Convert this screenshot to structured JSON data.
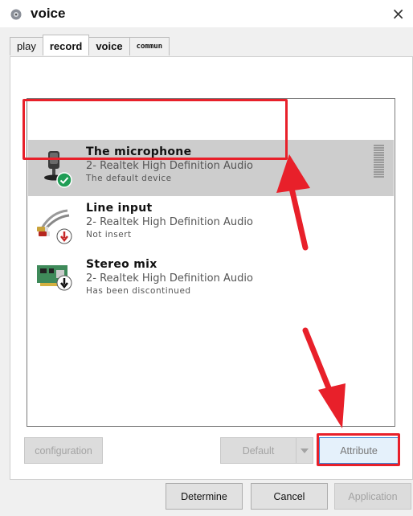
{
  "window": {
    "title": "voice",
    "close_glyph": "×"
  },
  "tabs": [
    {
      "label": "play"
    },
    {
      "label": "record"
    },
    {
      "label": "voice"
    },
    {
      "label": "commun"
    }
  ],
  "devices": [
    {
      "name": "The microphone",
      "driver": "2- Realtek High Definition Audio",
      "status": "The default device",
      "icon": "microphone-icon",
      "badge": "check-badge-icon",
      "selected": true
    },
    {
      "name": "Line input",
      "driver": "2- Realtek High Definition Audio",
      "status": "Not insert",
      "icon": "line-input-cable-icon",
      "badge": "down-arrow-red-badge-icon"
    },
    {
      "name": "Stereo mix",
      "driver": "2- Realtek High Definition Audio",
      "status": "Has been discontinued",
      "icon": "sound-card-icon",
      "badge": "down-arrow-black-badge-icon"
    }
  ],
  "buttons": {
    "configuration": "configuration",
    "default": "Default",
    "attribute": "Attribute",
    "determine": "Determine",
    "cancel": "Cancel",
    "application": "Application"
  },
  "colors": {
    "annotation_red": "#e8202a",
    "selection_gray": "#cdcdcd",
    "focus_blue": "#3c89d8"
  }
}
